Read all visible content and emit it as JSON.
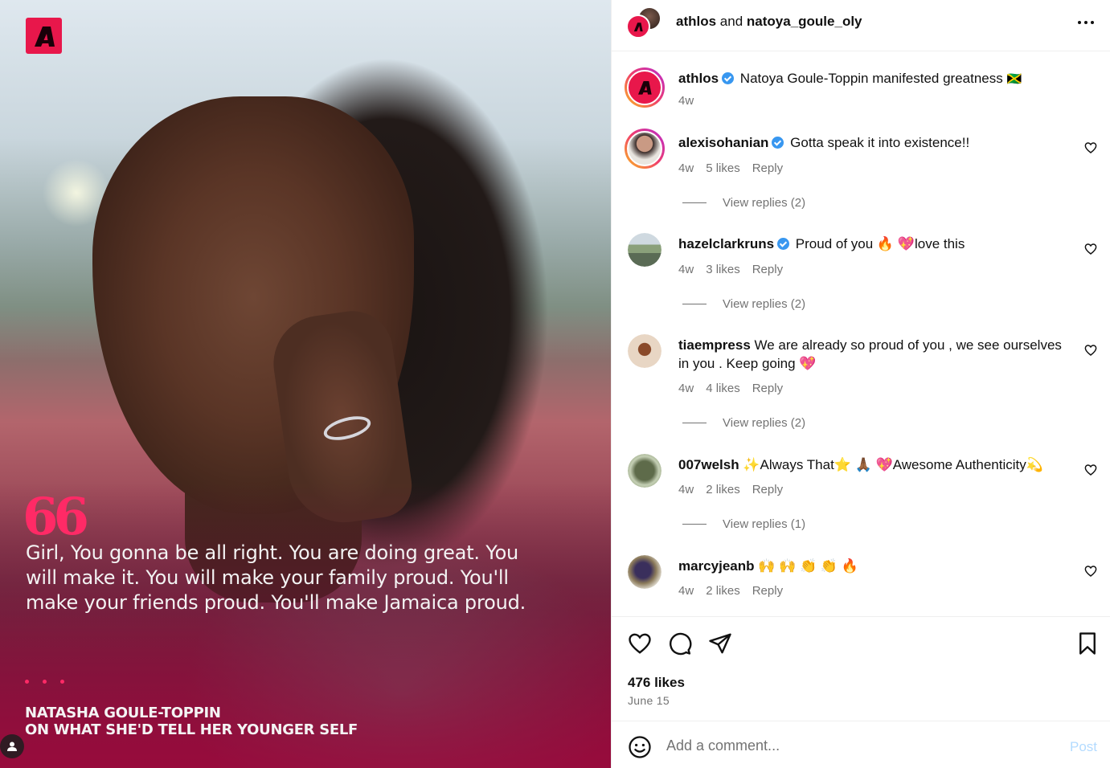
{
  "media": {
    "brand_logo_letter": "A",
    "quote_mark": "66",
    "quote_text": "Girl, You gonna be all right. You are doing great. You will make it. You will make your family proud. You'll make your friends proud. You'll make Jamaica proud.",
    "credit_line_1": "NATASHA GOULE-TOPPIN",
    "credit_line_2": "ON WHAT SHE'D TELL HER YOUNGER SELF",
    "brand_color": "#e8174b"
  },
  "header": {
    "user_1": "athlos",
    "joiner": "and",
    "user_2": "natoya_goule_oly"
  },
  "caption": {
    "user": "athlos",
    "text": "Natoya Goule-Toppin manifested greatness",
    "flag": "🇯🇲",
    "time": "4w"
  },
  "comments": [
    {
      "user": "alexisohanian",
      "verified": true,
      "text": "Gotta speak it into existence!!",
      "time": "4w",
      "likes": "5 likes",
      "reply": "Reply",
      "view_replies": "View replies (2)"
    },
    {
      "user": "hazelclarkruns",
      "verified": true,
      "text": "Proud of you 🔥 💖love this",
      "time": "4w",
      "likes": "3 likes",
      "reply": "Reply",
      "view_replies": "View replies (2)"
    },
    {
      "user": "tiaempress",
      "verified": false,
      "text": "We are already so proud of you , we see ourselves in you . Keep going 💖",
      "time": "4w",
      "likes": "4 likes",
      "reply": "Reply",
      "view_replies": "View replies (2)"
    },
    {
      "user": "007welsh",
      "verified": false,
      "text": "✨Always That⭐ 🙏🏾 💖Awesome Authenticity💫",
      "time": "4w",
      "likes": "2 likes",
      "reply": "Reply",
      "view_replies": "View replies (1)"
    },
    {
      "user": "marcyjeanb",
      "verified": false,
      "text": "🙌 🙌 👏 👏 🔥",
      "time": "4w",
      "likes": "2 likes",
      "reply": "Reply"
    }
  ],
  "actions": {
    "icons": [
      "heart-icon",
      "comment-icon",
      "share-icon",
      "bookmark-icon"
    ],
    "likes": "476 likes",
    "date": "June 15"
  },
  "comment_box": {
    "placeholder": "Add a comment...",
    "post_label": "Post"
  },
  "colors": {
    "verified": "#3897f0",
    "post_button_disabled": "#b3dbff",
    "muted": "#737373"
  }
}
